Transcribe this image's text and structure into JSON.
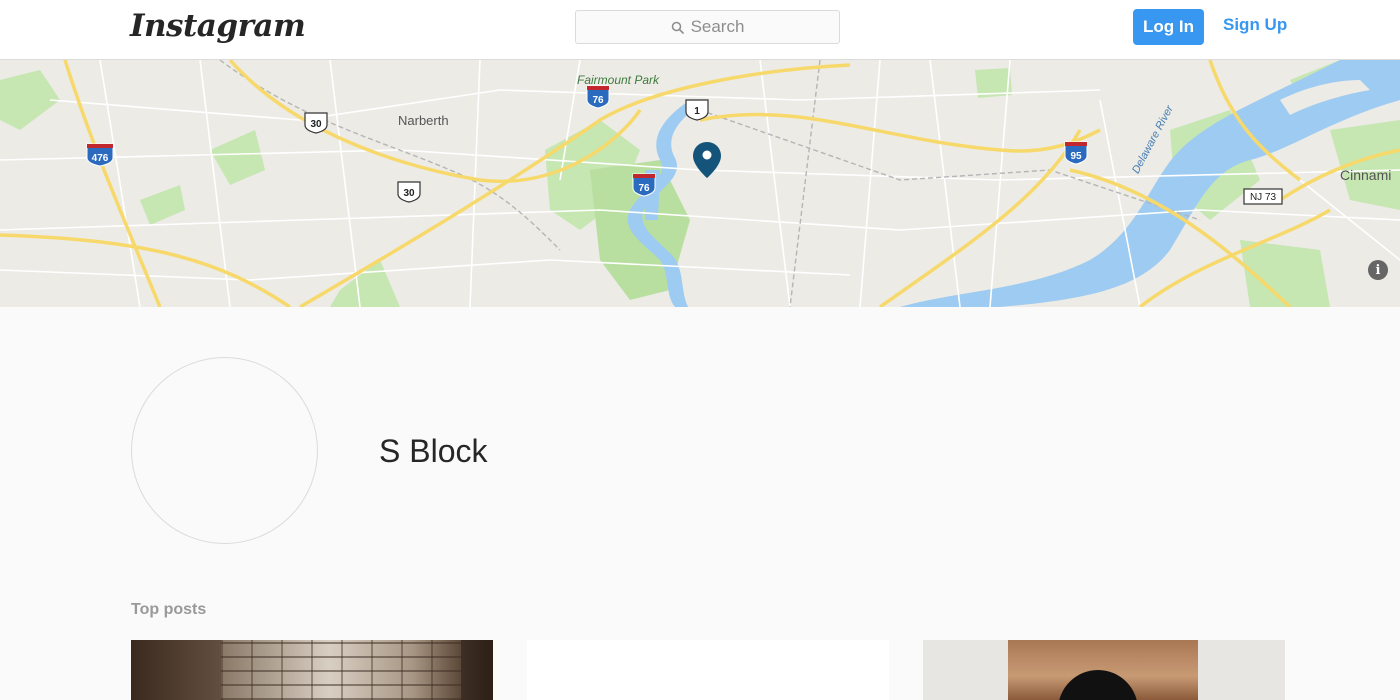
{
  "header": {
    "logo": "Instagram",
    "search_placeholder": "Search",
    "login_label": "Log In",
    "signup_label": "Sign Up"
  },
  "map": {
    "labels": {
      "fairmount_park": "Fairmount Park",
      "narberth": "Narberth",
      "cinnaminson": "Cinnami",
      "delaware_river": "Delaware River"
    },
    "shields": {
      "i476": "476",
      "i76_north": "76",
      "i76_south": "76",
      "us1": "1",
      "us30_north": "30",
      "us30_south": "30",
      "i95": "95",
      "nj73": "NJ 73"
    },
    "info_label": "i"
  },
  "place": {
    "name": "S Block"
  },
  "top_posts": {
    "title": "Top posts"
  },
  "colors": {
    "accent": "#3897f0",
    "pin": "#15547a",
    "water": "#9ecbf2",
    "park": "#c6e6b2",
    "highway": "#f7d96b"
  }
}
